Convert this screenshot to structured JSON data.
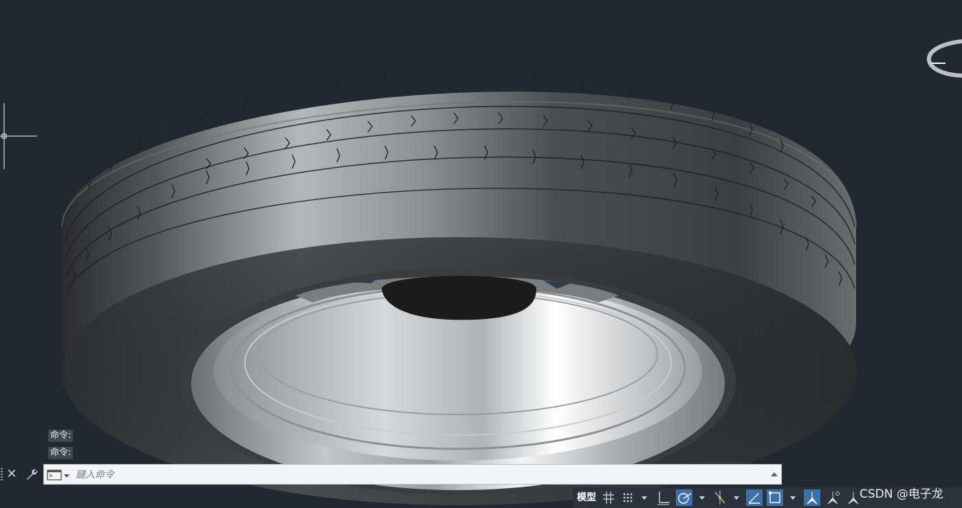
{
  "command_line": {
    "history": [
      "命令:",
      "命令:"
    ],
    "input_placeholder": "鍵入命令",
    "input_value": ""
  },
  "status_bar": {
    "model_tab_label": "模型",
    "buttons": [
      {
        "name": "grid",
        "icon": "grid-icon",
        "active": false
      },
      {
        "name": "snap",
        "icon": "snap-dots-icon",
        "active": false
      },
      {
        "name": "ortho",
        "icon": "ortho-icon",
        "active": false
      },
      {
        "name": "polar",
        "icon": "polar-tracking-icon",
        "active": true
      },
      {
        "name": "osnap-tracking",
        "icon": "object-snap-tracking-icon",
        "active": false
      },
      {
        "name": "osnap",
        "icon": "object-snap-icon",
        "active": true
      },
      {
        "name": "dynamic-ucs",
        "icon": "dynamic-ucs-icon",
        "active": true
      },
      {
        "name": "annotation-visibility",
        "icon": "annotation-icon",
        "active": true
      },
      {
        "name": "annotation-scale",
        "icon": "annotation-scale-icon",
        "active": false
      },
      {
        "name": "annotation-auto",
        "icon": "annotation-auto-icon",
        "active": false
      }
    ]
  },
  "watermark": "CSDN @电子龙",
  "colors": {
    "background": "#212830",
    "active_button": "#3d6fa8",
    "status_bar": "#2b323b"
  }
}
